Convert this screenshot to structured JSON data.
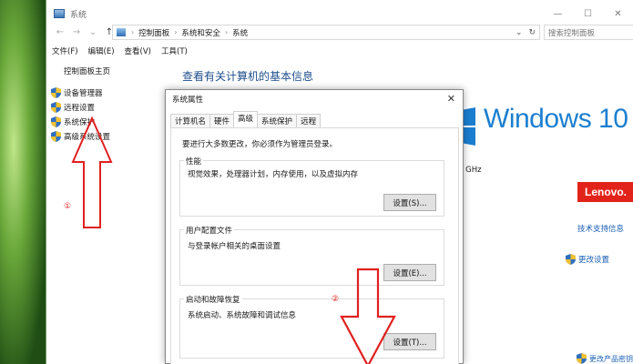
{
  "window": {
    "title": "系统",
    "controls": {
      "minimize": "—",
      "maximize": "☐",
      "close": "✕"
    }
  },
  "nav": {
    "back": "←",
    "forward": "→",
    "recent": "⌄",
    "up": "↑"
  },
  "address": {
    "crumbs": [
      "控制面板",
      "系统和安全",
      "系统"
    ],
    "separator": "›",
    "dropdown": "⌄",
    "refresh": "↻"
  },
  "search": {
    "placeholder": "搜索控制面板"
  },
  "menu": {
    "items": [
      "文件(F)",
      "编辑(E)",
      "查看(V)",
      "工具(T)"
    ]
  },
  "sidebar": {
    "home": "控制面板主页",
    "items": [
      "设备管理器",
      "远程设置",
      "系统保护",
      "高级系统设置"
    ]
  },
  "main": {
    "heading": "查看有关计算机的基本信息",
    "os_logo_text": "Windows 10",
    "ghz_text": "0 GHz",
    "oem_logo_text": "Lenovo.",
    "support_link": "技术支持信息",
    "change_settings_link": "更改设置",
    "change_key_link": "更改产品密钥"
  },
  "dialog": {
    "title": "系统属性",
    "close": "✕",
    "tabs": [
      "计算机名",
      "硬件",
      "高级",
      "系统保护",
      "远程"
    ],
    "active_tab": "高级",
    "note": "要进行大多数更改，你必须作为管理员登录。",
    "groups": [
      {
        "label": "性能",
        "desc": "视觉效果，处理器计划，内存使用，以及虚拟内存",
        "button": "设置(S)..."
      },
      {
        "label": "用户配置文件",
        "desc": "与登录帐户相关的桌面设置",
        "button": "设置(E)..."
      },
      {
        "label": "启动和故障恢复",
        "desc": "系统启动、系统故障和调试信息",
        "button": "设置(T)..."
      }
    ]
  },
  "annotations": {
    "step1": "①",
    "step2": "②"
  },
  "colors": {
    "link": "#1a5fb4",
    "heading": "#1e4e8c",
    "win10": "#1b7fd0",
    "lenovo": "#e2231a",
    "annotation": "#e02020"
  }
}
